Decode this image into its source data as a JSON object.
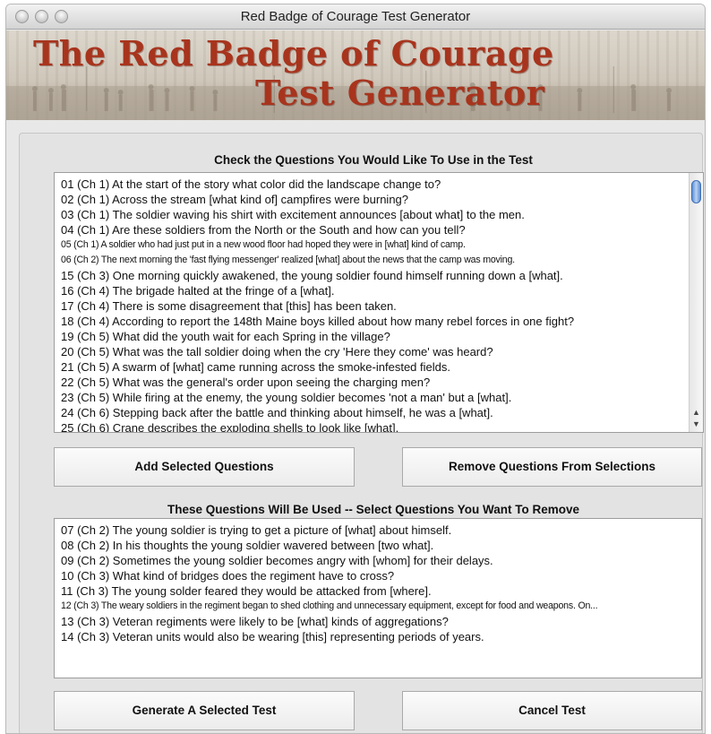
{
  "window": {
    "title": "Red Badge of Courage Test Generator"
  },
  "banner": {
    "line1": "The Red Badge of Courage",
    "line2": "Test Generator"
  },
  "available": {
    "label": "Check the Questions You Would Like To Use in the Test",
    "questions": [
      "01 (Ch 1)  At the start of the story what color did the landscape change to?",
      "02 (Ch 1)  Across the stream [what kind of] campfires were burning?",
      "03 (Ch 1)  The soldier waving his shirt with excitement announces [about what] to the men.",
      "04 (Ch 1)  Are these soldiers from the North or the South and how can you tell?",
      "05 (Ch 1)  A soldier who had just put in a new wood floor had hoped they were in [what] kind of camp.",
      "06 (Ch 2)  The next morning the 'fast flying messenger' realized [what] about the news that the camp was moving.",
      "15 (Ch 3)  One morning quickly awakened, the young soldier found himself running down a [what].",
      "16 (Ch 4)  The brigade halted at the fringe of a [what].",
      "17 (Ch 4)  There is some disagreement that [this] has been taken.",
      "18 (Ch 4)  According to report the 148th Maine boys killed about how many rebel forces in one fight?",
      "19 (Ch 5)  What did the youth wait for each Spring in the village?",
      "20 (Ch 5)  What was the tall soldier doing when the cry 'Here they come' was heard?",
      "21 (Ch 5)  A swarm of [what] came running across the smoke-infested fields.",
      "22 (Ch 5)  What was the general's order upon seeing the charging men?",
      "23 (Ch 5)  While firing at the enemy, the young soldier becomes 'not a man' but a [what].",
      "24 (Ch 6)  Stepping back after the battle and thinking about himself, he was a [what].",
      "25 (Ch 6)  Crane describes the exploding shells to look like [what]."
    ]
  },
  "buttons": {
    "add": "Add Selected Questions",
    "remove": "Remove Questions From Selections",
    "generate": "Generate A Selected Test",
    "cancel": "Cancel Test"
  },
  "selected": {
    "label": "These Questions Will Be Used -- Select Questions You Want To Remove",
    "questions": [
      "07 (Ch 2)  The young soldier is trying to get a picture of [what] about himself.",
      "08 (Ch 2)  In his thoughts the young soldier wavered between [two what].",
      "09 (Ch 2)  Sometimes the young soldier becomes angry with [whom] for their delays.",
      "10 (Ch 3)  What kind of bridges does the regiment have to cross?",
      "11 (Ch 3)  The young solder feared they would be attacked from [where].",
      "12 (Ch 3)  The weary soldiers in the regiment began to shed clothing and unnecessary equipment, except for food and weapons.  On...",
      "13 (Ch 3)  Veteran regiments were likely to be [what] kinds of aggregations?",
      "14 (Ch 3)  Veteran units would also be wearing [this] representing periods of years."
    ]
  },
  "icons": {
    "scroll_up": "▲",
    "scroll_down": "▼"
  },
  "colors": {
    "banner_title": "#a8341d",
    "scroll_thumb": "#5d8fd6"
  }
}
